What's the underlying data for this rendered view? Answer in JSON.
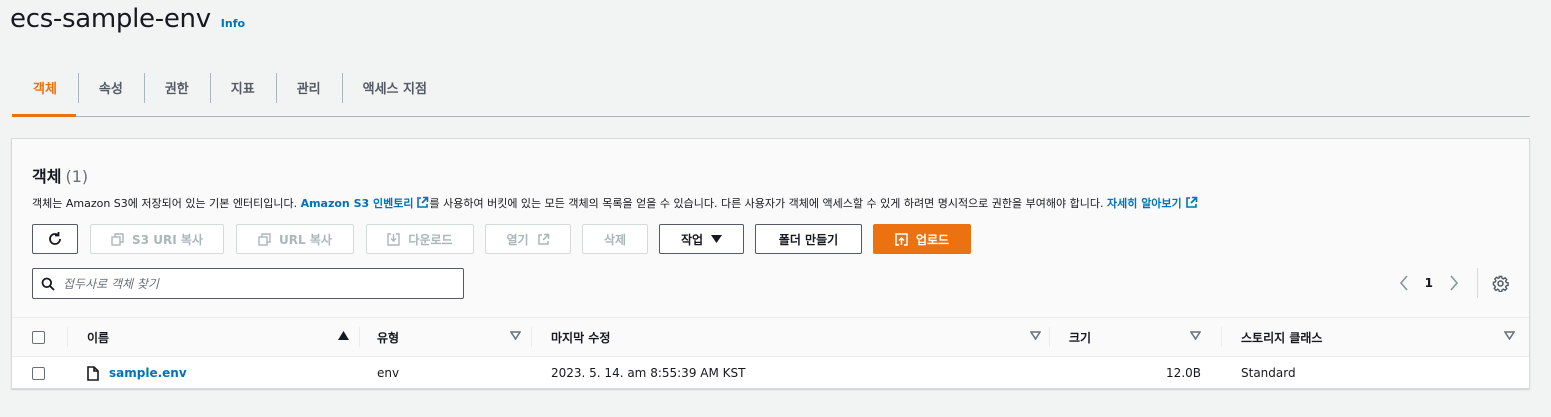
{
  "page": {
    "title": "ecs-sample-env",
    "info": "Info"
  },
  "tabs": [
    "객체",
    "속성",
    "권한",
    "지표",
    "관리",
    "액세스 지점"
  ],
  "panel": {
    "title": "객체",
    "count": "(1)",
    "desc_prefix": "객체는 Amazon S3에 저장되어 있는 기본 엔터티입니다.",
    "desc_link1": "Amazon S3 인벤토리",
    "desc_middle": "를 사용하여 버킷에 있는 모든 객체의 목록을 얻을 수 있습니다. 다른 사용자가 객체에 액세스할 수 있게 하려면 명시적으로 권한을 부여해야 합니다.",
    "desc_link2": "자세히 알아보기"
  },
  "toolbar": {
    "refresh": "refresh-icon",
    "copy_s3_uri": "S3 URI 복사",
    "copy_url": "URL 복사",
    "download": "다운로드",
    "open": "열기",
    "delete": "삭제",
    "actions": "작업",
    "create_folder": "폴더 만들기",
    "upload": "업로드"
  },
  "search": {
    "placeholder": "접두사로 객체 찾기"
  },
  "pagination": {
    "current_page": "1"
  },
  "table": {
    "columns": [
      "이름",
      "유형",
      "마지막 수정",
      "크기",
      "스토리지 클래스"
    ],
    "rows": [
      {
        "name": "sample.env",
        "type": "env",
        "last_modified": "2023. 5. 14. am 8:55:39 AM KST",
        "size": "12.0B",
        "storage_class": "Standard"
      }
    ]
  },
  "colors": {
    "accent": "#ec7211",
    "link": "#0073bb",
    "text": "#16191f",
    "muted": "#687078"
  }
}
